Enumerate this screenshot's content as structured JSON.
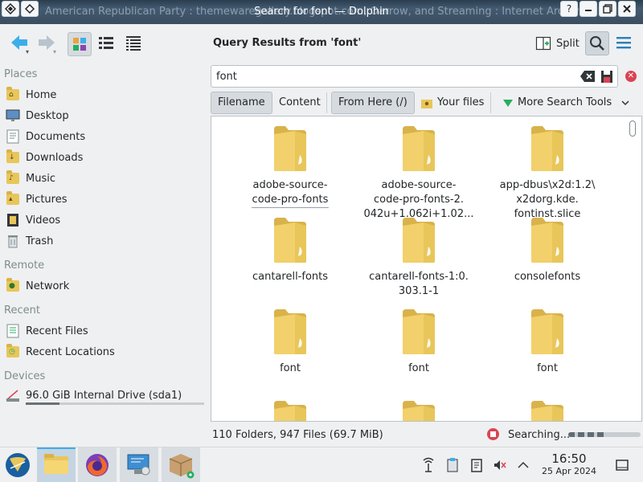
{
  "titlebar": {
    "title": "Search for font — Dolphin",
    "background_text": "American Republican Party : themewaregallery.blogspot.com, Oarrow, and Streaming : Internet Archive"
  },
  "toolbar": {
    "back_icon": "back-arrow-icon",
    "forward_icon": "forward-arrow-icon",
    "view_modes": [
      "icons-view",
      "compact-view",
      "details-view"
    ],
    "active_view": "icons-view",
    "query_title": "Query Results from 'font'",
    "split_label": "Split",
    "search_active": true
  },
  "sidebar": {
    "sections": {
      "places": "Places",
      "remote": "Remote",
      "recent": "Recent",
      "devices": "Devices"
    },
    "places": [
      {
        "label": "Home",
        "icon": "home-folder-icon"
      },
      {
        "label": "Desktop",
        "icon": "desktop-icon"
      },
      {
        "label": "Documents",
        "icon": "documents-folder-icon"
      },
      {
        "label": "Downloads",
        "icon": "downloads-folder-icon"
      },
      {
        "label": "Music",
        "icon": "music-folder-icon"
      },
      {
        "label": "Pictures",
        "icon": "pictures-folder-icon"
      },
      {
        "label": "Videos",
        "icon": "videos-folder-icon"
      },
      {
        "label": "Trash",
        "icon": "trash-icon"
      }
    ],
    "remote": [
      {
        "label": "Network",
        "icon": "network-icon"
      }
    ],
    "recent": [
      {
        "label": "Recent Files",
        "icon": "recent-files-icon"
      },
      {
        "label": "Recent Locations",
        "icon": "recent-locations-icon"
      }
    ],
    "devices": [
      {
        "label": "96.0 GiB Internal Drive (sda1)",
        "icon": "hard-drive-icon",
        "usage": 0.19
      }
    ]
  },
  "search": {
    "value": "font",
    "filters": {
      "filename": "Filename",
      "content": "Content",
      "from_here": "From Here (/)",
      "your_files": "Your files",
      "more_tools": "More Search Tools"
    },
    "checked": [
      "Filename",
      "From Here (/)"
    ]
  },
  "files": [
    {
      "name": "adobe-source-code-pro-fonts",
      "lines": [
        "adobe-source-",
        "code-pro-fonts"
      ],
      "selected": true
    },
    {
      "name": "adobe-source-code-pro-fonts-2.042u+1.062i+1.02...",
      "lines": [
        "adobe-source-",
        "code-pro-fonts-2.",
        "042u+1.062i+1.02..."
      ]
    },
    {
      "name": "app-dbus\\x2d:1.2\\x2dorg.kde.fontinst.slice",
      "lines": [
        "app-dbus\\x2d:1.2\\",
        "x2dorg.kde.",
        "fontinst.slice"
      ]
    },
    {
      "name": "cantarell-fonts",
      "lines": [
        "cantarell-fonts"
      ]
    },
    {
      "name": "cantarell-fonts-1:0.303.1-1",
      "lines": [
        "cantarell-fonts-1:0.",
        "303.1-1"
      ]
    },
    {
      "name": "consolefonts",
      "lines": [
        "consolefonts"
      ]
    },
    {
      "name": "font",
      "lines": [
        "font"
      ]
    },
    {
      "name": "font",
      "lines": [
        "font"
      ]
    },
    {
      "name": "font",
      "lines": [
        "font"
      ]
    },
    {
      "name": "",
      "lines": []
    },
    {
      "name": "",
      "lines": []
    },
    {
      "name": "",
      "lines": []
    }
  ],
  "status": {
    "summary": "110 Folders, 947 Files (69.7 MiB)",
    "state": "Searching...",
    "progress": 0.5
  },
  "taskbar": {
    "apps": [
      "kde-launcher-icon",
      "dolphin-file-manager-icon",
      "firefox-icon",
      "system-settings-icon",
      "package-installer-icon"
    ],
    "tray": [
      "network-tray-icon",
      "clipboard-tray-icon",
      "notes-tray-icon",
      "volume-muted-tray-icon",
      "chevron-up-icon"
    ],
    "time": "16:50",
    "date": "25 Apr 2024"
  },
  "colors": {
    "accent": "#3daee9",
    "folder": "#e8c65a",
    "stop": "#da4453"
  }
}
